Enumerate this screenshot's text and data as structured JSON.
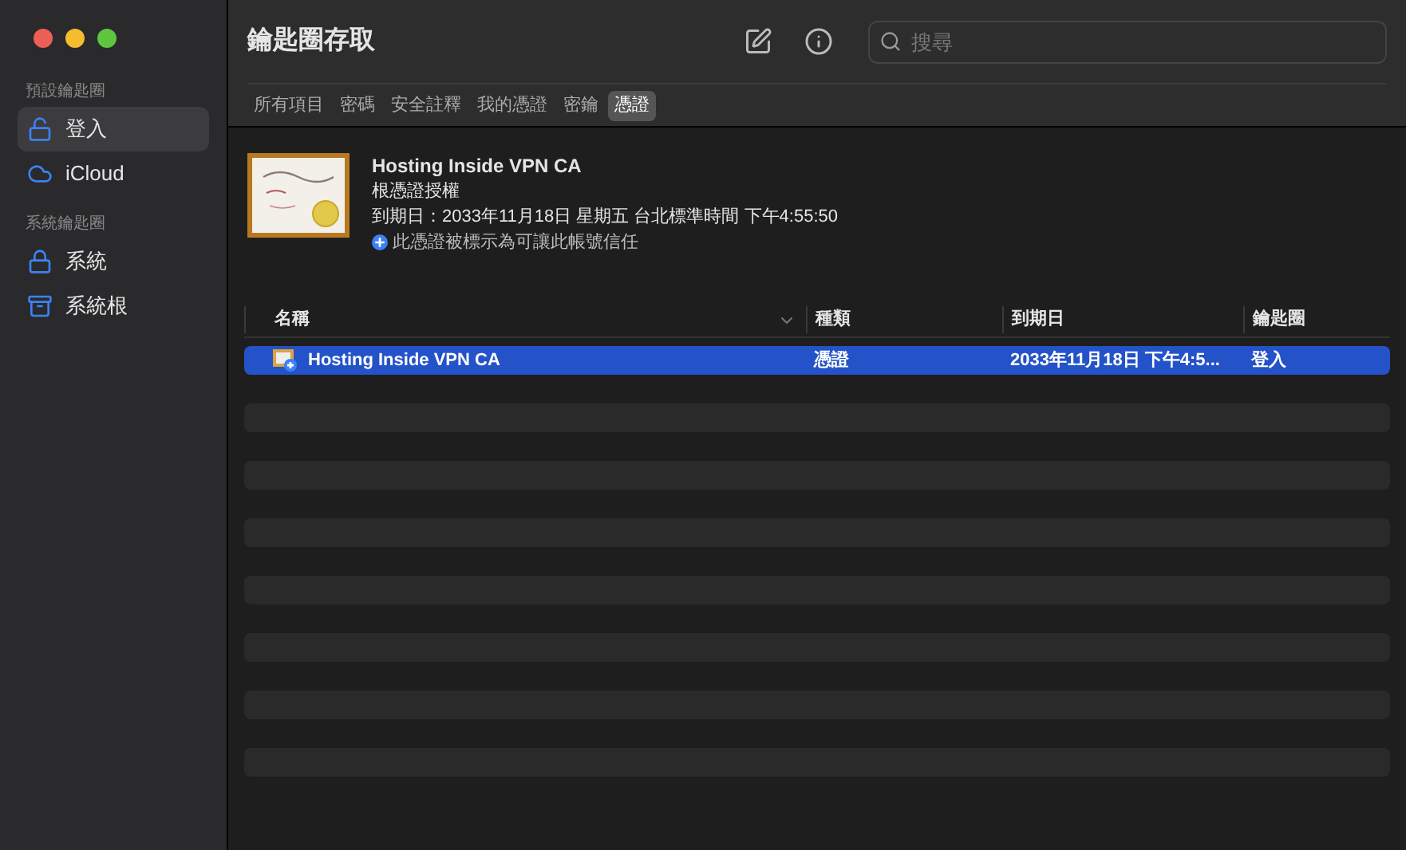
{
  "window": {
    "title": "鑰匙圈存取"
  },
  "search": {
    "placeholder": "搜尋"
  },
  "sidebar": {
    "sections": [
      {
        "title": "預設鑰匙圈",
        "items": [
          {
            "label": "登入",
            "kind": "unlocked",
            "selected": true
          },
          {
            "label": "iCloud",
            "kind": "cloud",
            "selected": false
          }
        ]
      },
      {
        "title": "系統鑰匙圈",
        "items": [
          {
            "label": "系統",
            "kind": "locked",
            "selected": false
          },
          {
            "label": "系統根",
            "kind": "cabinet",
            "selected": false
          }
        ]
      }
    ]
  },
  "tabs": [
    {
      "label": "所有項目",
      "selected": false
    },
    {
      "label": "密碼",
      "selected": false
    },
    {
      "label": "安全註釋",
      "selected": false
    },
    {
      "label": "我的憑證",
      "selected": false
    },
    {
      "label": "密鑰",
      "selected": false
    },
    {
      "label": "憑證",
      "selected": true
    }
  ],
  "detail": {
    "name": "Hosting Inside VPN CA",
    "type": "根憑證授權",
    "expiry": "到期日：2033年11月18日 星期五 台北標準時間 下午4:55:50",
    "trust": "此憑證被標示為可讓此帳號信任"
  },
  "table": {
    "columns": [
      {
        "label": "名稱",
        "sorted": true
      },
      {
        "label": "種類",
        "sorted": false
      },
      {
        "label": "到期日",
        "sorted": false
      },
      {
        "label": "鑰匙圈",
        "sorted": false
      }
    ],
    "rows": [
      {
        "cells": [
          "Hosting Inside VPN CA",
          "憑證",
          "2033年11月18日 下午4:5...",
          "登入"
        ],
        "selected": true
      }
    ]
  }
}
